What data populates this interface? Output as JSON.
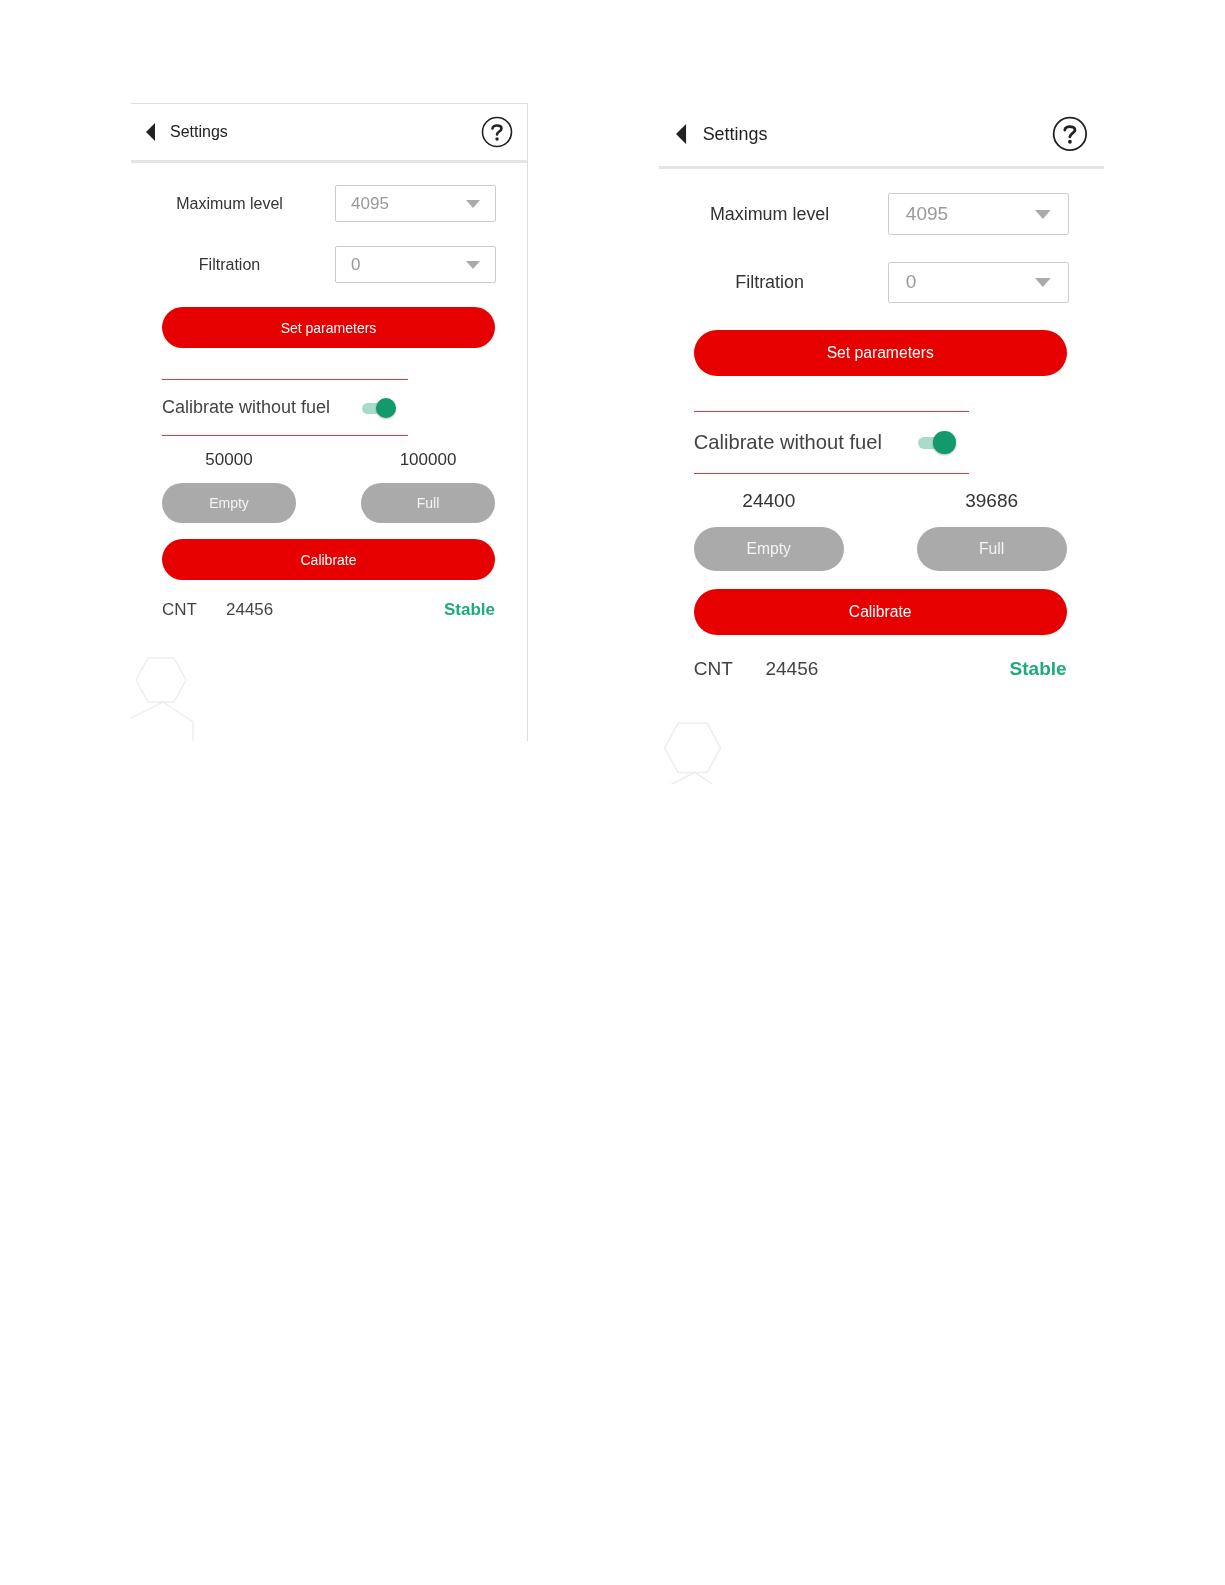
{
  "screens": [
    {
      "header": {
        "title": "Settings"
      },
      "fields": [
        {
          "label": "Maximum level",
          "value": "4095"
        },
        {
          "label": "Filtration",
          "value": "0"
        }
      ],
      "set_button": "Set parameters",
      "calibrate_without_fuel": {
        "label": "Calibrate without fuel",
        "on": true
      },
      "readings": [
        {
          "value": "50000",
          "button": "Empty"
        },
        {
          "value": "100000",
          "button": "Full"
        }
      ],
      "calibrate_button": "Calibrate",
      "counter": {
        "label": "CNT",
        "value": "24456",
        "status": "Stable"
      }
    },
    {
      "header": {
        "title": "Settings"
      },
      "fields": [
        {
          "label": "Maximum level",
          "value": "4095"
        },
        {
          "label": "Filtration",
          "value": "0"
        }
      ],
      "set_button": "Set parameters",
      "calibrate_without_fuel": {
        "label": "Calibrate without fuel",
        "on": true
      },
      "readings": [
        {
          "value": "24400",
          "button": "Empty"
        },
        {
          "value": "39686",
          "button": "Full"
        }
      ],
      "calibrate_button": "Calibrate",
      "counter": {
        "label": "CNT",
        "value": "24456",
        "status": "Stable"
      }
    }
  ]
}
